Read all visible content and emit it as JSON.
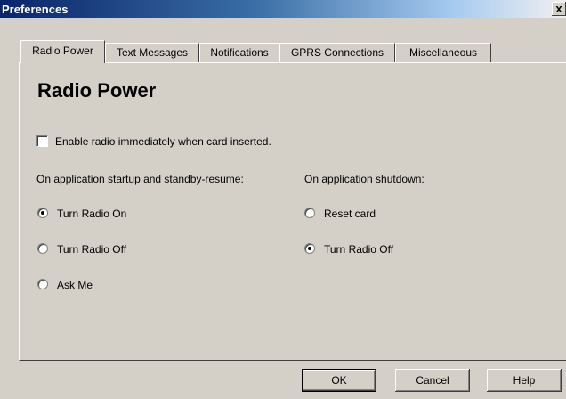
{
  "window": {
    "title": "Preferences",
    "close_glyph": "x"
  },
  "tabs": [
    {
      "label": "Radio Power",
      "active": true
    },
    {
      "label": "Text Messages",
      "active": false
    },
    {
      "label": "Notifications",
      "active": false
    },
    {
      "label": "GPRS Connections",
      "active": false
    },
    {
      "label": "Miscellaneous",
      "active": false
    }
  ],
  "page": {
    "heading": "Radio Power",
    "enable_checkbox": {
      "label": "Enable radio immediately when card inserted.",
      "checked": false
    },
    "startup": {
      "label": "On application startup and standby-resume:",
      "options": [
        {
          "label": "Turn Radio On",
          "selected": true
        },
        {
          "label": "Turn Radio Off",
          "selected": false
        },
        {
          "label": "Ask Me",
          "selected": false
        }
      ]
    },
    "shutdown": {
      "label": "On application shutdown:",
      "options": [
        {
          "label": "Reset card",
          "selected": false
        },
        {
          "label": "Turn Radio Off",
          "selected": true
        }
      ]
    }
  },
  "buttons": {
    "ok": "OK",
    "cancel": "Cancel",
    "help": "Help"
  },
  "colors": {
    "face": "#d4d0c8",
    "title_start": "#0a246a",
    "title_end": "#a6caf0"
  }
}
